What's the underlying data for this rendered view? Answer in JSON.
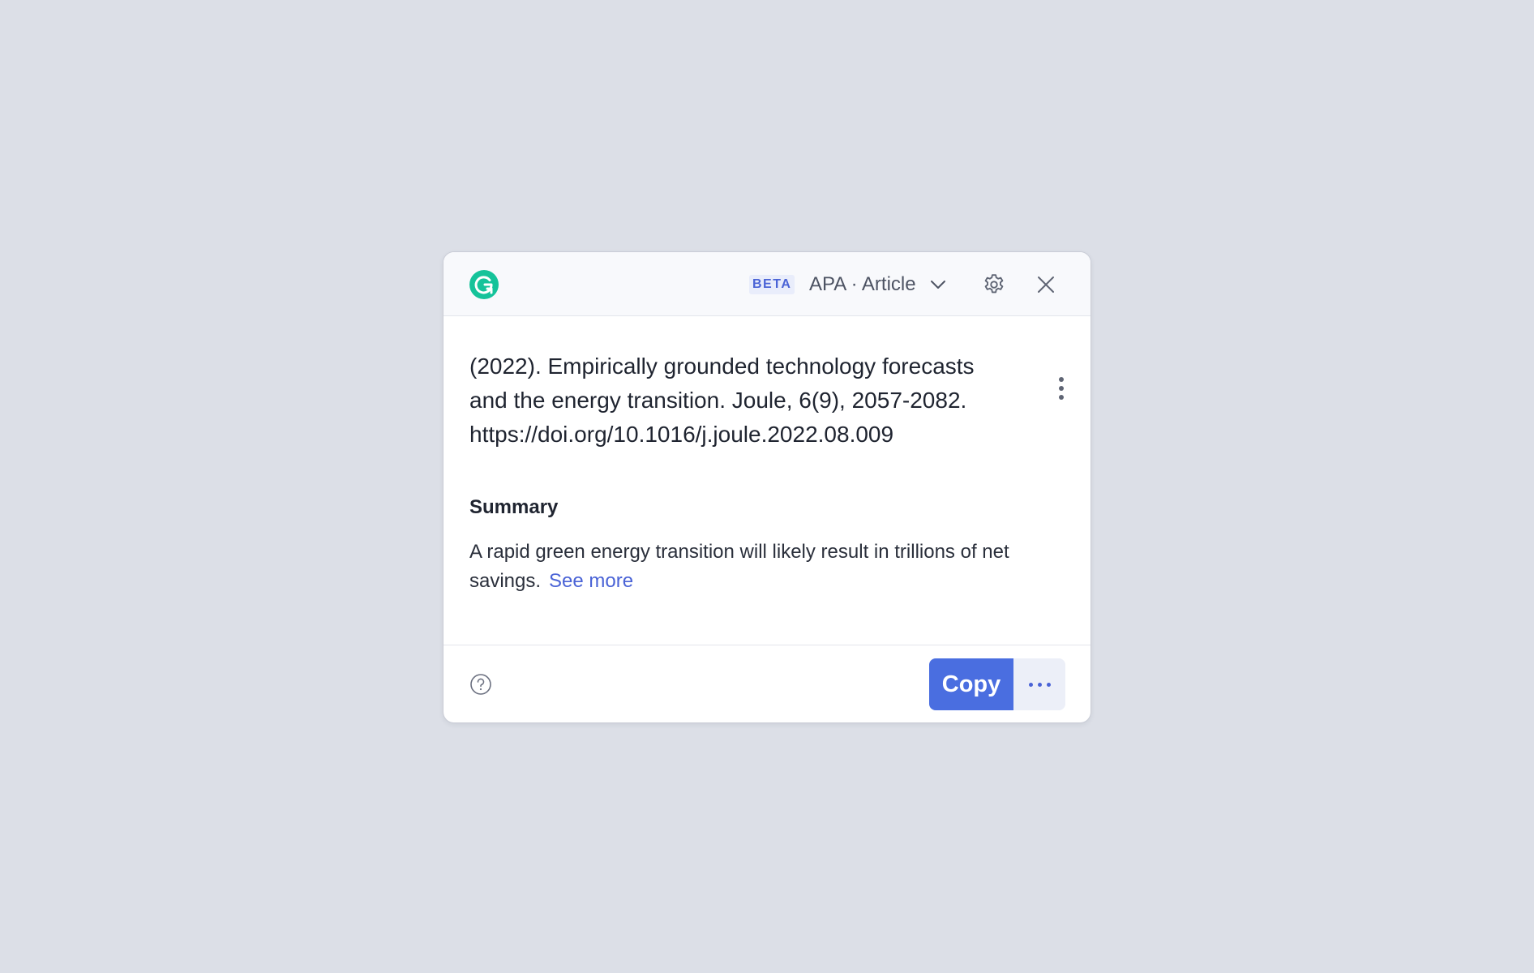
{
  "header": {
    "beta_badge": "BETA",
    "citation_style": "APA · Article",
    "icons": {
      "logo": "grammarly-logo-icon",
      "dropdown": "chevron-down-icon",
      "settings": "gear-icon",
      "close": "close-icon"
    }
  },
  "citation": {
    "line1": "(2022). Empirically grounded technology forecasts",
    "line2": "and the energy transition. Joule, 6(9), 2057-2082.",
    "line3": "https://doi.org/10.1016/j.joule.2022.08.009",
    "menu_icon": "vertical-dots-icon"
  },
  "summary": {
    "heading": "Summary",
    "text": "A rapid green energy transition will likely result in trillions of net savings.",
    "see_more": "See more"
  },
  "footer": {
    "help_icon": "help-circle-icon",
    "copy_label": "Copy",
    "more_icon": "horizontal-dots-icon"
  },
  "colors": {
    "background": "#dcdfe7",
    "brand_green": "#15c39a",
    "accent_blue": "#4a6ee0",
    "link_blue": "#4a63d6"
  }
}
